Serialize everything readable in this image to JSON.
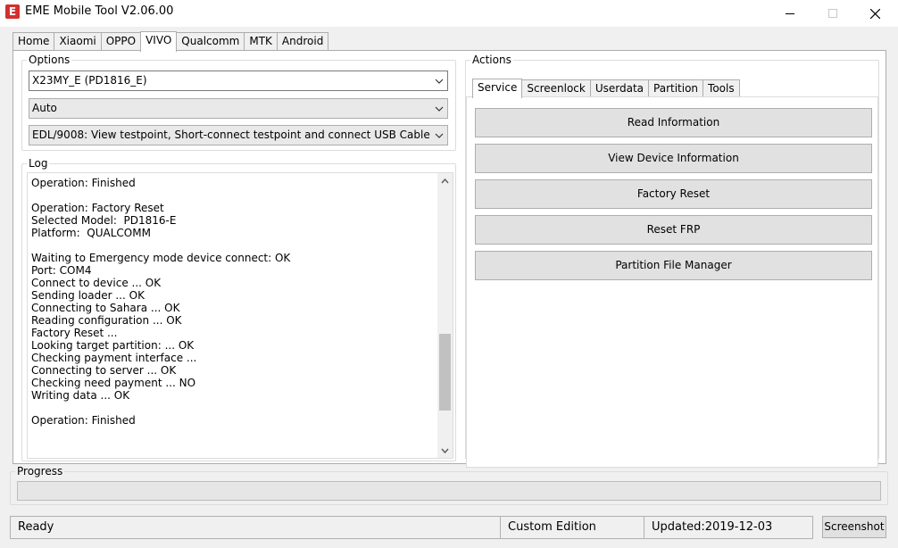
{
  "window": {
    "title": "EME Mobile Tool V2.06.00",
    "icon_letter": "E",
    "icon": "eme-app-icon"
  },
  "main_tabs": [
    {
      "label": "Home"
    },
    {
      "label": "Xiaomi"
    },
    {
      "label": "OPPO"
    },
    {
      "label": "VIVO",
      "active": true
    },
    {
      "label": "Qualcomm"
    },
    {
      "label": "MTK"
    },
    {
      "label": "Android"
    }
  ],
  "options": {
    "label": "Options",
    "model": "X23MY_E (PD1816_E)",
    "mode": "Auto",
    "connection": "EDL/9008: View testpoint, Short-connect testpoint and connect USB Cable"
  },
  "log": {
    "label": "Log",
    "lines": [
      "Operation: Finished",
      "",
      "Operation: Factory Reset",
      "Selected Model:  PD1816-E",
      "Platform:  QUALCOMM",
      "",
      "Waiting to Emergency mode device connect: OK",
      "Port: COM4",
      "Connect to device ... OK",
      "Sending loader ... OK",
      "Connecting to Sahara ... OK",
      "Reading configuration ... OK",
      "Factory Reset ...",
      "Looking target partition: ... OK",
      "Checking payment interface ...",
      "Connecting to server ... OK",
      "Checking need payment ... NO",
      "Writing data ... OK",
      "",
      "Operation: Finished"
    ],
    "scroll_position": 0.82
  },
  "actions": {
    "label": "Actions",
    "tabs": [
      {
        "label": "Service",
        "active": true
      },
      {
        "label": "Screenlock"
      },
      {
        "label": "Userdata"
      },
      {
        "label": "Partition"
      },
      {
        "label": "Tools"
      }
    ],
    "buttons": [
      {
        "label": "Read Information"
      },
      {
        "label": "View Device Information"
      },
      {
        "label": "Factory Reset"
      },
      {
        "label": "Reset FRP"
      },
      {
        "label": "Partition File Manager"
      }
    ]
  },
  "progress": {
    "label": "Progress",
    "value": 0
  },
  "status": {
    "state": "Ready",
    "edition": "Custom Edition",
    "updated": "Updated:2019-12-03"
  },
  "screenshot_button": "Screenshot",
  "colors": {
    "icon_red": "#d32f2f",
    "progress_green": "#06b025"
  }
}
